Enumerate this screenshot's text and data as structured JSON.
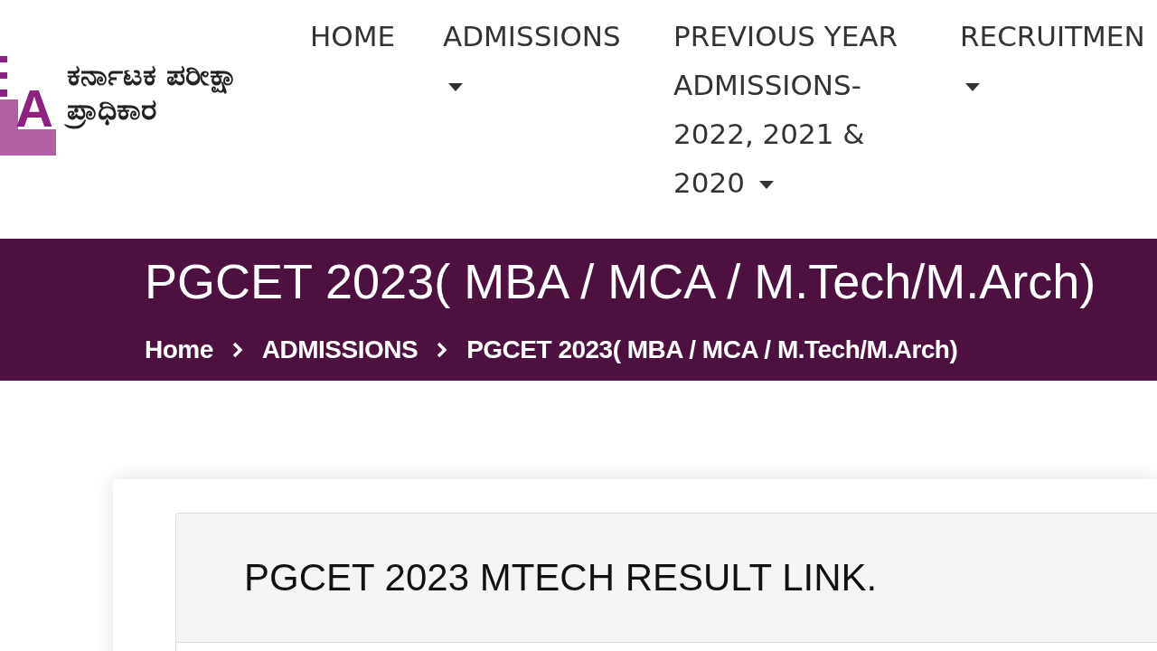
{
  "header": {
    "logo": {
      "letter": "A"
    },
    "org_name": "ಕರ್ನಾಟಕ ಪರೀಕ್ಷಾ ಪ್ರಾಧಿಕಾರ"
  },
  "nav": [
    {
      "label": "HOME",
      "dropdown": false
    },
    {
      "label": "ADMISSIONS",
      "dropdown": true
    },
    {
      "label": "PREVIOUS YEAR ADMISSIONS-2022, 2021 & 2020",
      "dropdown": true
    },
    {
      "label": "RECRUITMEN",
      "dropdown": true
    }
  ],
  "banner": {
    "title": "PGCET 2023( MBA / MCA / M.Tech/M.Arch)",
    "breadcrumb": [
      "Home",
      "ADMISSIONS",
      "PGCET 2023( MBA / MCA / M.Tech/M.Arch)"
    ]
  },
  "panel": {
    "heading": "PGCET 2023 MTECH RESULT LINK."
  }
}
